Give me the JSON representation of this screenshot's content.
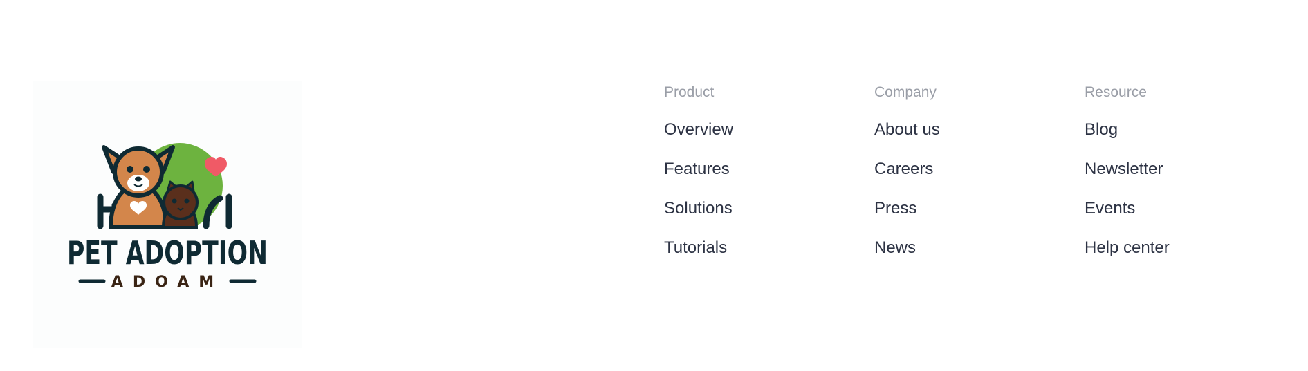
{
  "logo": {
    "name": "Pet Adoption logo",
    "title_text": "PET ADOPTION",
    "subtitle_text": "ADOAM",
    "colors": {
      "dark": "#0f2a33",
      "dog": "#d3864b",
      "cat": "#5a2f1c",
      "green": "#6db33f",
      "heart": "#f05a66"
    }
  },
  "footer": {
    "columns": [
      {
        "heading": "Product",
        "links": [
          "Overview",
          "Features",
          "Solutions",
          "Tutorials"
        ]
      },
      {
        "heading": "Company",
        "links": [
          "About us",
          "Careers",
          "Press",
          "News"
        ]
      },
      {
        "heading": "Resource",
        "links": [
          "Blog",
          "Newsletter",
          "Events",
          "Help center"
        ]
      }
    ]
  },
  "colors": {
    "heading": "#9a9ea7",
    "link": "#2d3344",
    "background": "#ffffff"
  }
}
